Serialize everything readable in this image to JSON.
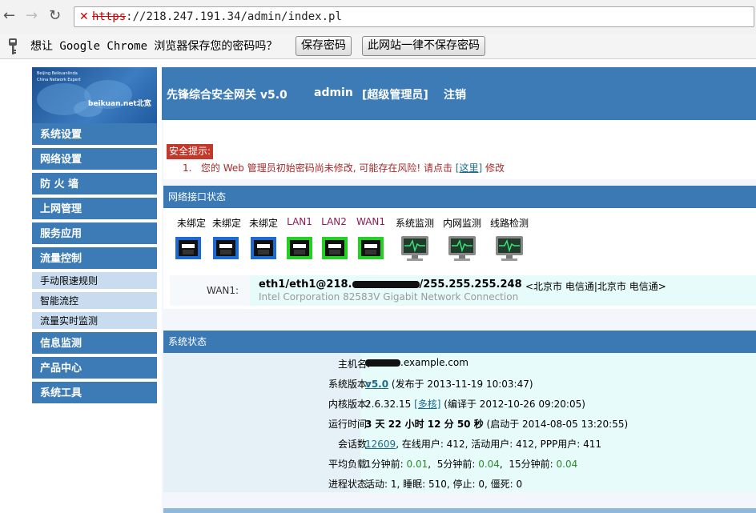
{
  "browser": {
    "url_protocol": "https",
    "url_rest": "://218.247.191.34/admin/index.pl",
    "infobar_text": "想让 Google Chrome 浏览器保存您的密码吗？",
    "save_password_button": "保存密码",
    "never_save_button": "此网站一律不保存密码"
  },
  "logo": {
    "line1": "Beijing Beikuanlinda",
    "line2": "China Network Expert",
    "brand": "beikuan.net北宽"
  },
  "sidebar": {
    "items": [
      {
        "label": "系统设置"
      },
      {
        "label": "网络设置"
      },
      {
        "label": "防 火 墙"
      },
      {
        "label": "上网管理"
      },
      {
        "label": "服务应用"
      },
      {
        "label": "流量控制"
      },
      {
        "label": "手动限速规则"
      },
      {
        "label": "智能流控"
      },
      {
        "label": "流量实时监测"
      },
      {
        "label": "信息监测"
      },
      {
        "label": "产品中心"
      },
      {
        "label": "系统工具"
      }
    ]
  },
  "header": {
    "product": "先锋综合安全网关 v5.0",
    "user": "admin",
    "role": "[超级管理员]",
    "logout": "注销"
  },
  "security": {
    "title": "安全提示:",
    "item_num": "1.",
    "message": "您的 Web 管理员初始密码尚未修改, 可能存在风险!  请点击",
    "link": "[这里]",
    "suffix": "修改"
  },
  "interfaces": {
    "title": "网络接口状态",
    "ports": [
      {
        "label": "未绑定",
        "state": "blue"
      },
      {
        "label": "未绑定",
        "state": "blue"
      },
      {
        "label": "未绑定",
        "state": "blue"
      },
      {
        "label": "LAN1",
        "state": "green"
      },
      {
        "label": "LAN2",
        "state": "green"
      },
      {
        "label": "WAN1",
        "state": "green"
      },
      {
        "label": "系统监测",
        "state": "monitor"
      },
      {
        "label": "内网监测",
        "state": "monitor"
      },
      {
        "label": "线路检测",
        "state": "monitor"
      }
    ],
    "wan_label": "WAN1:",
    "wan_addr_pre": "eth1/eth1@218.",
    "wan_addr_post": "/255.255.255.248",
    "wan_isp": "<北京市 电信通|北京市 电信通>",
    "wan_nic": "Intel Corporation 82583V Gigabit Network Connection"
  },
  "system": {
    "title": "系统状态",
    "hostname_label": "主机名:",
    "hostname_value": ".example.com",
    "version_label": "系统版本:",
    "version_link": "v5.0",
    "version_extra": "(发布于 2013-11-19 10:03:47)",
    "kernel_label": "内核版本:",
    "kernel_value": "2.6.32.15",
    "kernel_link": "[多核]",
    "kernel_extra": "(编译于 2012-10-26 09:20:05)",
    "uptime_label": "运行时间:",
    "uptime_value": "3 天 22 小时 12 分 50 秒",
    "uptime_extra": "(启动于 2014-08-05 13:20:55)",
    "sessions_label": "会话数:",
    "sessions_link": "12609",
    "sessions_extra": ", 在线用户: 412, 活动用户: 412, PPP用户: 411",
    "load_label": "平均负载:",
    "load_1_label": "1分钟前:",
    "load_1": "0.01",
    "load_5_label": "5分钟前:",
    "load_5": "0.04",
    "load_15_label": "15分钟前:",
    "load_15": "0.04",
    "proc_label": "进程状态:",
    "proc_value": "活动: 1, 睡眠: 510, 停止: 0, 僵死: 0"
  },
  "colors": {
    "accent": "#3c7bb5",
    "link": "#1a6b8a",
    "load_green": "#2a8a2a",
    "warn_red": "#c0392b"
  }
}
